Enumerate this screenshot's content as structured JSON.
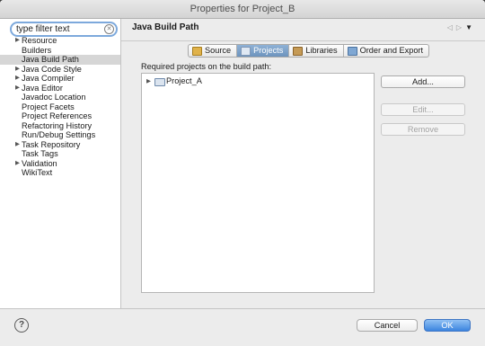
{
  "window": {
    "title": "Properties for Project_B"
  },
  "filter": {
    "placeholder": "type filter text",
    "value": "type filter text"
  },
  "tree": {
    "items": [
      {
        "label": "Resource",
        "expandable": true,
        "selected": false
      },
      {
        "label": "Builders",
        "expandable": false,
        "selected": false
      },
      {
        "label": "Java Build Path",
        "expandable": false,
        "selected": true
      },
      {
        "label": "Java Code Style",
        "expandable": true,
        "selected": false
      },
      {
        "label": "Java Compiler",
        "expandable": true,
        "selected": false
      },
      {
        "label": "Java Editor",
        "expandable": true,
        "selected": false
      },
      {
        "label": "Javadoc Location",
        "expandable": false,
        "selected": false
      },
      {
        "label": "Project Facets",
        "expandable": false,
        "selected": false
      },
      {
        "label": "Project References",
        "expandable": false,
        "selected": false
      },
      {
        "label": "Refactoring History",
        "expandable": false,
        "selected": false
      },
      {
        "label": "Run/Debug Settings",
        "expandable": false,
        "selected": false
      },
      {
        "label": "Task Repository",
        "expandable": true,
        "selected": false
      },
      {
        "label": "Task Tags",
        "expandable": false,
        "selected": false
      },
      {
        "label": "Validation",
        "expandable": true,
        "selected": false
      },
      {
        "label": "WikiText",
        "expandable": false,
        "selected": false
      }
    ]
  },
  "page": {
    "title": "Java Build Path"
  },
  "tabs": [
    {
      "label": "Source",
      "icon": "source-folder-icon",
      "active": false
    },
    {
      "label": "Projects",
      "icon": "projects-icon",
      "active": true
    },
    {
      "label": "Libraries",
      "icon": "libraries-icon",
      "active": false
    },
    {
      "label": "Order and Export",
      "icon": "order-export-icon",
      "active": false
    }
  ],
  "projects": {
    "heading": "Required projects on the build path:",
    "items": [
      {
        "label": "Project_A"
      }
    ]
  },
  "actions": {
    "add": "Add...",
    "edit": "Edit...",
    "remove": "Remove"
  },
  "footer": {
    "cancel": "Cancel",
    "ok": "OK"
  },
  "colors": {
    "accent": "#3b85df",
    "selection": "#d6d6d6",
    "active_tab": "#6d93bd"
  }
}
